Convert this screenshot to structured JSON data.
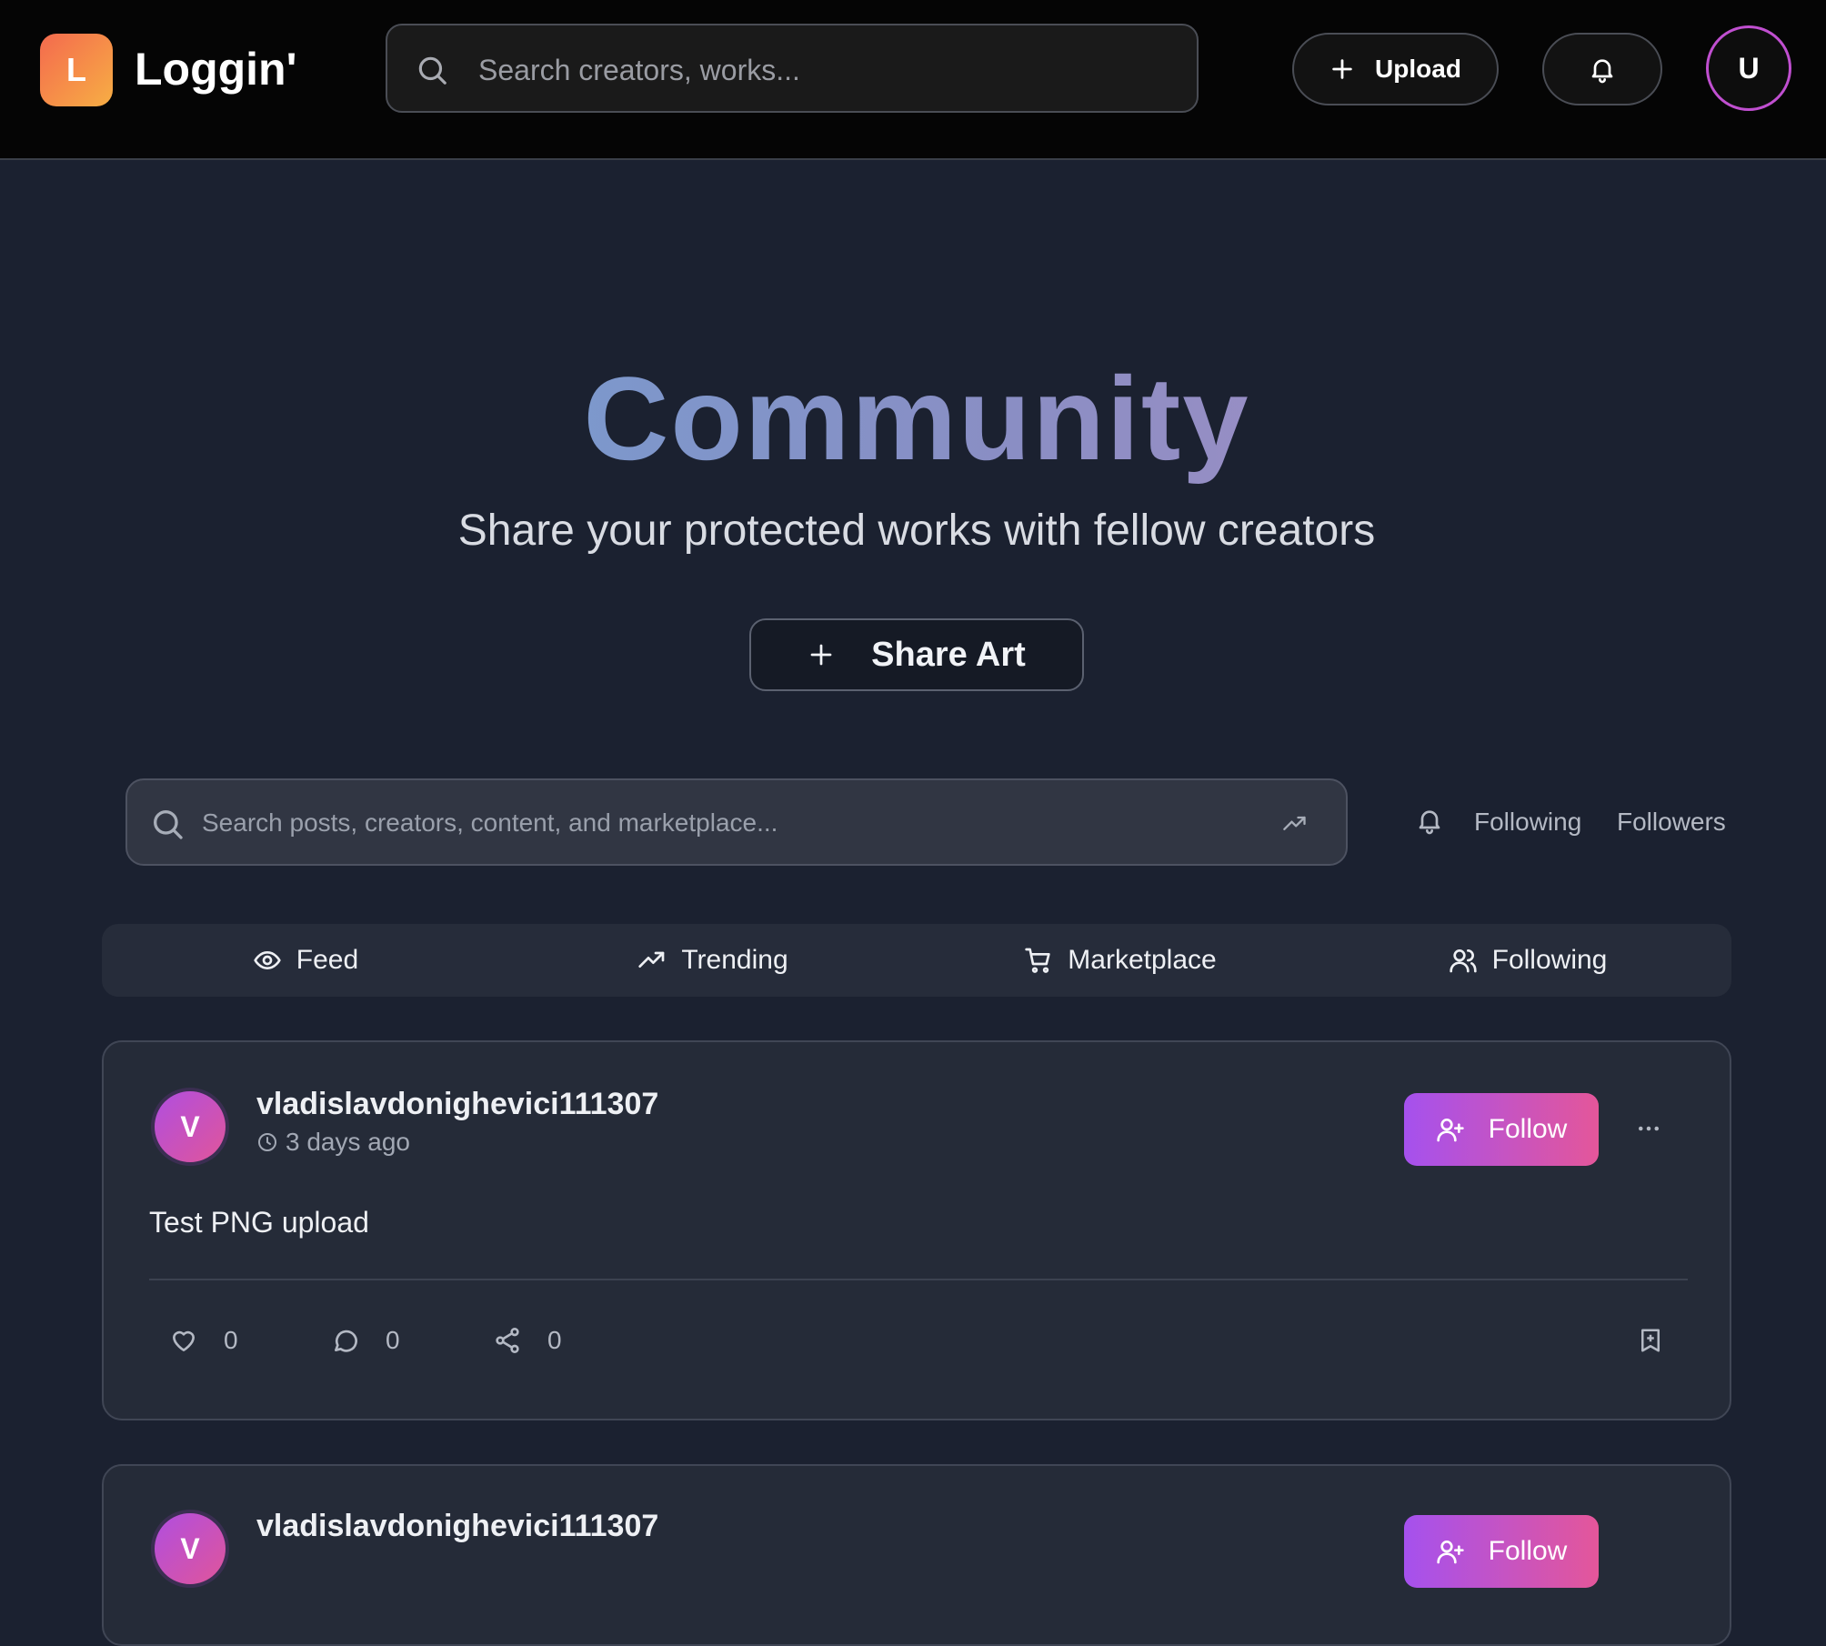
{
  "app": {
    "logo_letter": "L",
    "brand": "Loggin'",
    "search_placeholder": "Search creators, works...",
    "upload_label": "Upload",
    "user_initial": "U"
  },
  "hero": {
    "title": "Community",
    "subtitle": "Share your protected works with fellow creators",
    "share_label": "Share Art"
  },
  "content_search": {
    "placeholder": "Search posts, creators, content, and marketplace...",
    "following_link": "Following",
    "followers_link": "Followers"
  },
  "tabs": [
    {
      "label": "Feed",
      "icon": "eye-icon"
    },
    {
      "label": "Trending",
      "icon": "trending-icon"
    },
    {
      "label": "Marketplace",
      "icon": "cart-icon"
    },
    {
      "label": "Following",
      "icon": "users-icon"
    }
  ],
  "posts": [
    {
      "avatar_letter": "V",
      "username": "vladislavdonighevici111307",
      "time": "3 days ago",
      "follow_label": "Follow",
      "text": "Test PNG upload",
      "likes": "0",
      "comments": "0",
      "shares": "0"
    },
    {
      "avatar_letter": "V",
      "username": "vladislavdonighevici111307",
      "follow_label": "Follow"
    }
  ],
  "colors": {
    "accent_start": "#a551ee",
    "accent_end": "#e4569a",
    "logo_start": "#f46a4e",
    "logo_end": "#f7ae44",
    "background": "#1b2130"
  }
}
